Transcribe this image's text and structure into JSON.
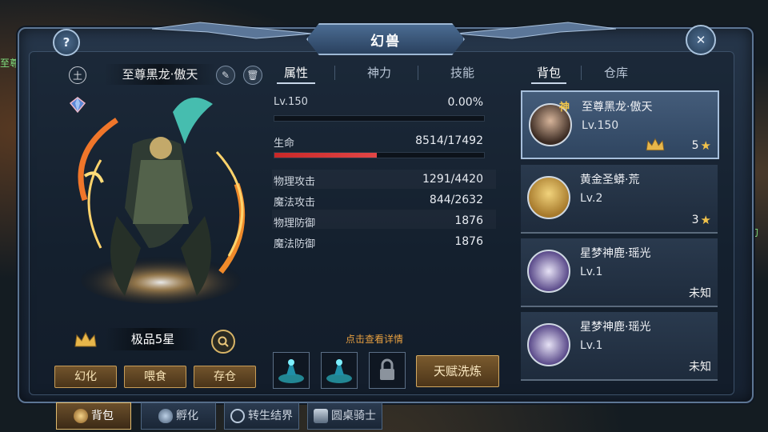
{
  "window": {
    "title": "幻兽"
  },
  "header": {
    "help_icon": "question-icon",
    "close_icon": "close-icon"
  },
  "pet": {
    "element_badge": "土",
    "name": "至尊黑龙·傲天",
    "grade": "极品5星",
    "actions": [
      "幻化",
      "喂食",
      "存仓"
    ]
  },
  "stat_tabs": [
    "属性",
    "神力",
    "技能"
  ],
  "active_stat_tab": 0,
  "stats": {
    "level_label": "Lv.150",
    "exp_percent": "0.00%",
    "exp_fraction": 0.0,
    "hp_label": "生命",
    "hp_value": "8514/17492",
    "hp_fraction": 0.487,
    "rows": [
      {
        "k": "物理攻击",
        "v": "1291/4420"
      },
      {
        "k": "魔法攻击",
        "v": "844/2632"
      },
      {
        "k": "物理防御",
        "v": "1876"
      },
      {
        "k": "魔法防御",
        "v": "1876"
      }
    ]
  },
  "hint": "点击查看详情",
  "talent_button": "天赋洗炼",
  "list_tabs": [
    "背包",
    "仓库"
  ],
  "active_list_tab": 0,
  "pets": [
    {
      "name": "至尊黑龙·傲天",
      "level": "Lv.150",
      "stars": "5",
      "selected": true,
      "badge": "神"
    },
    {
      "name": "黄金圣蟒·荒",
      "level": "Lv.2",
      "stars": "3",
      "selected": false
    },
    {
      "name": "星梦神鹿·瑶光",
      "level": "Lv.1",
      "status": "未知",
      "selected": false
    },
    {
      "name": "星梦神鹿·瑶光",
      "level": "Lv.1",
      "status": "未知",
      "selected": false
    }
  ],
  "bottom_tabs": [
    {
      "label": "背包",
      "icon": "beast-head-icon",
      "active": true
    },
    {
      "label": "孵化",
      "icon": "egg-icon",
      "active": false
    },
    {
      "label": "转生结界",
      "icon": "rebirth-icon",
      "active": false
    },
    {
      "label": "圆桌骑士",
      "icon": "round-table-icon",
      "active": false
    }
  ],
  "colors": {
    "accent_gold": "#d2a860",
    "hp_red": "#d83030",
    "panel": "#1f2e42"
  }
}
